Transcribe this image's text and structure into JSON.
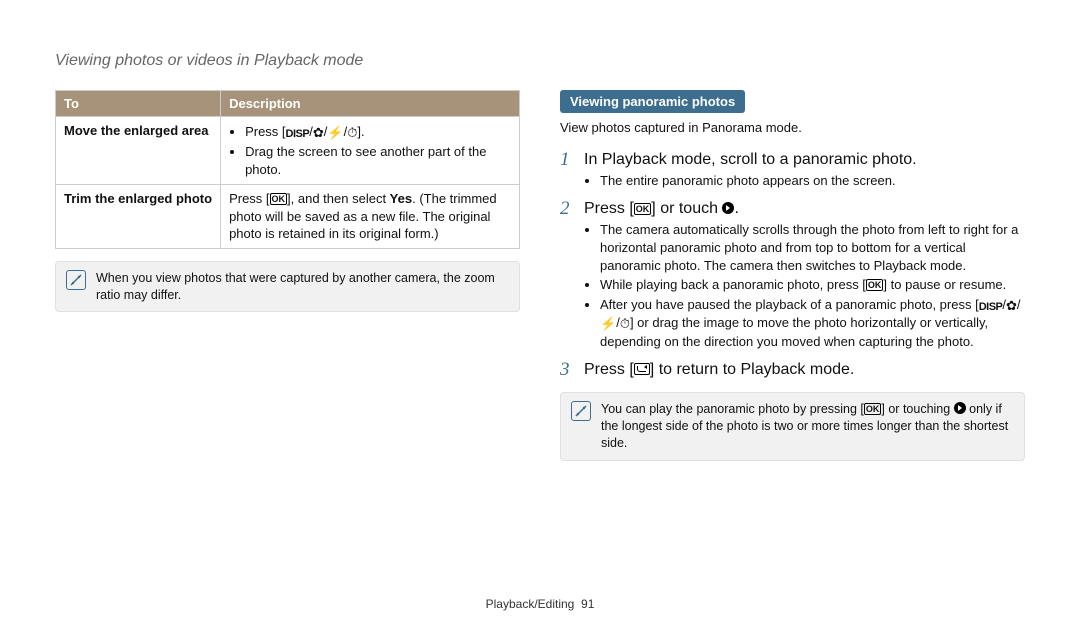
{
  "page_title": "Viewing photos or videos in Playback mode",
  "table": {
    "head_to": "To",
    "head_desc": "Description",
    "row1_label": "Move the enlarged area",
    "row1_b1a": "Press [",
    "row1_b1b": "].",
    "row1_b2": "Drag the screen to see another part of the photo.",
    "row2_label": "Trim the enlarged photo",
    "row2_a": "Press [",
    "row2_b": "], and then select ",
    "row2_yes": "Yes",
    "row2_c": ". (The trimmed photo will be saved as a new file. The original photo is retained in its original form.)"
  },
  "left_note": "When you view photos that were captured by another camera, the zoom ratio may differ.",
  "section_title": "Viewing panoramic photos",
  "section_sub": "View photos captured in Panorama mode.",
  "steps": {
    "s1": "In Playback mode, scroll to a panoramic photo.",
    "s1_b1": "The entire panoramic photo appears on the screen.",
    "s2a": "Press [",
    "s2b": "] or touch ",
    "s2c": ".",
    "s2_b1": "The camera automatically scrolls through the photo from left to right for a horizontal panoramic photo and from top to bottom for a vertical panoramic photo. The camera then switches to Playback mode.",
    "s2_b2a": "While playing back a panoramic photo, press [",
    "s2_b2b": "] to pause or resume.",
    "s2_b3a": "After you have paused the playback of a panoramic photo, press [",
    "s2_b3b": "] or drag the image to move the photo horizontally or vertically, depending on the direction you moved when capturing the photo.",
    "s3a": "Press [",
    "s3b": "] to return to Playback mode."
  },
  "right_note_a": "You can play the panoramic photo by pressing [",
  "right_note_b": "] or touching ",
  "right_note_c": " only if the longest side of the photo is two or more times longer than the shortest side.",
  "footer_section": "Playback/Editing",
  "footer_page": "91",
  "icons": {
    "disp": "DISP",
    "ok": "OK",
    "flower": "✿",
    "bolt": "⚡",
    "timer": "⏱",
    "sep": "/"
  }
}
